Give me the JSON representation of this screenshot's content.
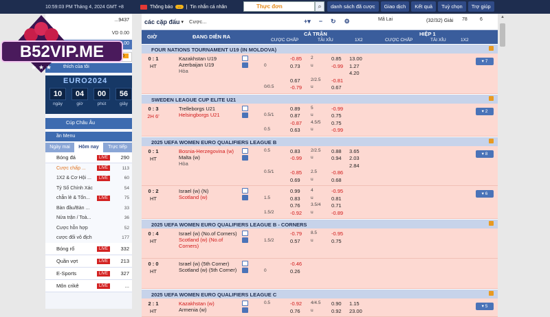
{
  "top": {
    "time": "10:59:03 PM Tháng 4, 2024 GMT +8",
    "notice": "Thông báo",
    "notice_badge": "...",
    "message": "Tin nhắn cá nhân",
    "search_placeholder": "Thực đơn",
    "nav": [
      "danh sách đã cược",
      "Giao dịch",
      "Kết quả",
      "Tuỳ chọn",
      "Trợ giúp"
    ]
  },
  "left": {
    "account_id": "...9437",
    "balance": "VD 0.00",
    "balance2": "0.00",
    "pending": "26",
    "favorites": "thích của tôi",
    "euro": {
      "title": "EURO2024",
      "days": "10",
      "hours": "04",
      "minutes": "00",
      "seconds": "56",
      "lbl_days": "ngày",
      "lbl_hours": "giờ",
      "lbl_minutes": "phút",
      "lbl_seconds": "giây"
    },
    "cup": "Cúp Châu Âu",
    "menu": "ần Menu",
    "tabs": [
      "Ngày mai",
      "Hôm nay",
      "Trực tiếp"
    ],
    "live_label": "LIVE",
    "sports": [
      {
        "name": "Bóng đá",
        "count": "290"
      }
    ],
    "subs": [
      {
        "name": "Cược chấp ...",
        "count": "113"
      },
      {
        "name": "1X2 & Cơ Hội ...",
        "count": "60"
      },
      {
        "name": "Tỷ Số Chính Xác",
        "count": "54"
      },
      {
        "name": "chẵn lẻ & Tổn...",
        "count": "75"
      },
      {
        "name": "Bàn đầu/Bàn ...",
        "count": "33"
      },
      {
        "name": "Nửa trận / Toà...",
        "count": "36"
      },
      {
        "name": "Cược hỗn hợp",
        "count": "52"
      },
      {
        "name": "cược đối vô địch",
        "count": "177"
      }
    ],
    "sports2": [
      {
        "name": "Bóng rổ",
        "count": "332"
      },
      {
        "name": "Quần vợt",
        "count": "213"
      },
      {
        "name": "E-Sports",
        "count": "327"
      },
      {
        "name": "Môn crikê",
        "count": "..."
      }
    ]
  },
  "main": {
    "title": "các cặp đấu",
    "bet_type": "Cược...",
    "market": "Mã Lai",
    "count": "(32/32) Giải",
    "live_count": "78",
    "fav_count": "6",
    "hdr": {
      "time": "GIỜ",
      "event": "ĐANG DIỄN RA",
      "full": "CẢ TRẬN",
      "half": "HIỆP 1",
      "hdp": "CƯỢC CHẤP",
      "ou": "TÀI XỈU",
      "x12": "1X2"
    }
  },
  "leagues": [
    {
      "name": "FOUR NATIONS TOURNAMENT U19 (IN MOLDOVA)",
      "more": "7",
      "score": "0 : 1",
      "status": "HT",
      "home": "Kazakhstan U19",
      "away": "Azerbaijan U19",
      "draw": "Hòa",
      "lines": [
        [
          "",
          "-0.85",
          "2",
          "0.85",
          "13.00"
        ],
        [
          "0",
          "0.73",
          "u",
          "-0.99",
          "1.27"
        ],
        [
          "",
          "",
          "",
          "",
          "4.20"
        ],
        [
          "",
          "0.67",
          "2/2.5",
          "-0.81",
          ""
        ],
        [
          "0/0.5",
          "-0.79",
          "u",
          "0.67",
          ""
        ]
      ]
    },
    {
      "name": "SWEDEN LEAGUE CUP ELITE U21",
      "more": "2",
      "score": "0 : 3",
      "status": "2H 6'",
      "home": "Trelleborgs U21",
      "away": "Helsingborgs U21",
      "draw": "",
      "lines": [
        [
          "",
          "0.89",
          "5",
          "-0.99",
          ""
        ],
        [
          "0.5/1",
          "0.87",
          "u",
          "0.75",
          ""
        ],
        [
          "",
          "-0.87",
          "4.5/5",
          "0.75",
          ""
        ],
        [
          "0.5",
          "0.63",
          "u",
          "-0.99",
          ""
        ]
      ]
    },
    {
      "name": "2025 UEFA WOMEN EURO QUALIFIERS LEAGUE B",
      "more": "8",
      "score": "0 : 1",
      "status": "HT",
      "home": "Bosnia-Herzegovina (w)",
      "away": "Malta (w)",
      "draw": "Hòa",
      "lines": [
        [
          "0.5",
          "0.83",
          "2/2.5",
          "0.88",
          "3.65"
        ],
        [
          "",
          "-0.99",
          "u",
          "0.94",
          "2.03"
        ],
        [
          "",
          "",
          "",
          "",
          "2.84"
        ],
        [
          "0.5/1",
          "-0.85",
          "2.5",
          "-0.86",
          ""
        ],
        [
          "",
          "0.69",
          "u",
          "0.68",
          ""
        ]
      ]
    },
    {
      "name": "",
      "more": "6",
      "score": "0 : 2",
      "status": "HT",
      "home": "Israel (w) (N)",
      "away": "Scotland (w)",
      "draw": "",
      "lines": [
        [
          "",
          "0.99",
          "4",
          "-0.95",
          ""
        ],
        [
          "1.5",
          "0.83",
          "u",
          "0.81",
          ""
        ],
        [
          "",
          "0.76",
          "3.5/4",
          "0.71",
          ""
        ],
        [
          "1.5/2",
          "-0.92",
          "u",
          "-0.89",
          ""
        ]
      ]
    },
    {
      "name": "2025 UEFA WOMEN EURO QUALIFIERS LEAGUE B - CORNERS",
      "more": "",
      "score": "0 : 4",
      "status": "HT",
      "home": "Israel (w) (No.of Corners)",
      "away": "Scotland (w) (No.of Corners)",
      "draw": "",
      "lines": [
        [
          "",
          "-0.79",
          "8.5",
          "-0.95",
          ""
        ],
        [
          "1.5/2",
          "0.57",
          "u",
          "0.75",
          ""
        ]
      ]
    },
    {
      "name": "",
      "more": "",
      "score": "0 : 0",
      "status": "HT",
      "home": "Israel (w) (5th Corner)",
      "away": "Scotland (w) (5th Corner)",
      "draw": "",
      "lines": [
        [
          "",
          "-0.46",
          "",
          "",
          ""
        ],
        [
          "0",
          "0.26",
          "",
          "",
          ""
        ]
      ]
    },
    {
      "name": "2025 UEFA WOMEN EURO QUALIFIERS LEAGUE C",
      "more": "5",
      "score": "2 : 1",
      "status": "HT",
      "home": "Kazakhstan (w)",
      "away": "Armenia (w)",
      "draw": "",
      "lines": [
        [
          "0.5",
          "-0.92",
          "4/4.5",
          "0.90",
          "1.15"
        ],
        [
          "",
          "0.76",
          "u",
          "0.92",
          "23.00"
        ]
      ]
    }
  ],
  "logo": {
    "text": "B52VIP.ME"
  }
}
